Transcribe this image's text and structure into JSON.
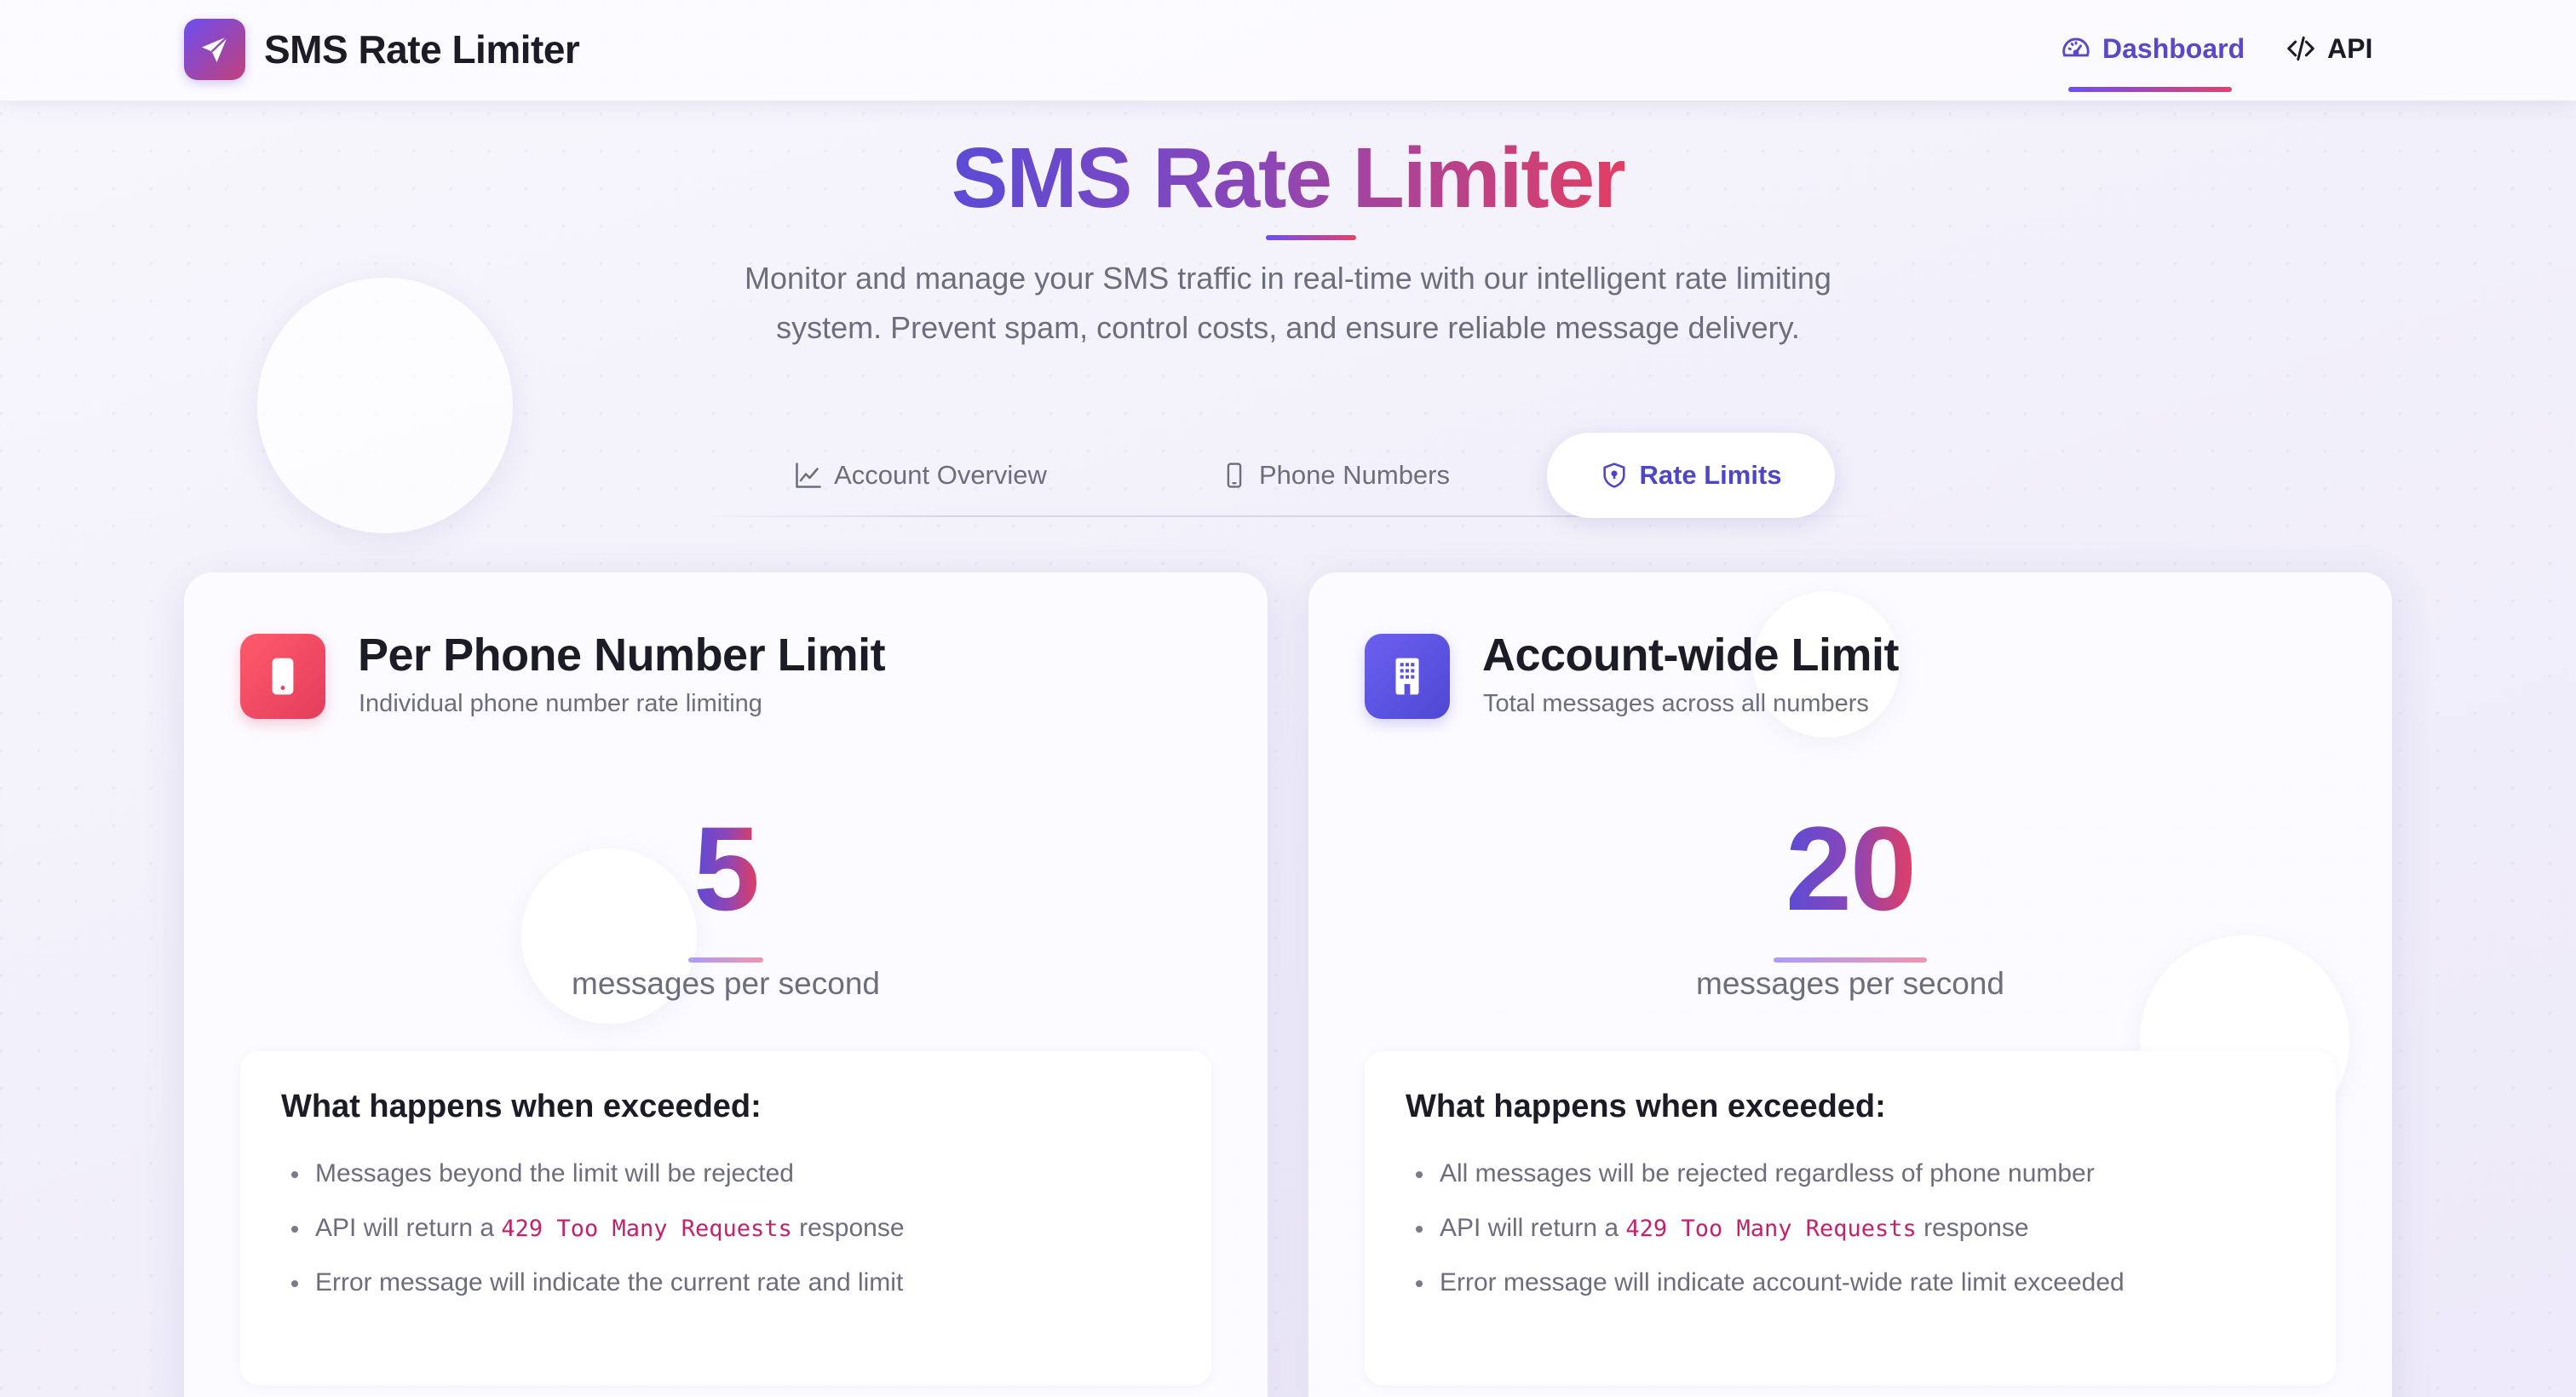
{
  "app": {
    "brand_name": "SMS Rate Limiter",
    "accent_gradient": [
      "#6d4ef0",
      "#e2426b"
    ]
  },
  "nav": {
    "items": [
      {
        "label": "Dashboard",
        "icon": "gauge-icon",
        "active": true
      },
      {
        "label": "API",
        "icon": "code-icon",
        "active": false
      }
    ]
  },
  "hero": {
    "title": "SMS Rate Limiter",
    "subtitle_line1": "Monitor and manage your SMS traffic in real-time with our intelligent rate limiting",
    "subtitle_line2": "system. Prevent spam, control costs, and ensure reliable message delivery."
  },
  "tabs": [
    {
      "label": "Account Overview",
      "icon": "line-chart-icon",
      "active": false
    },
    {
      "label": "Phone Numbers",
      "icon": "smartphone-icon",
      "active": false
    },
    {
      "label": "Rate Limits",
      "icon": "shield-icon",
      "active": true
    }
  ],
  "cards": [
    {
      "title": "Per Phone Number Limit",
      "subtitle": "Individual phone number rate limiting",
      "icon": "phone-icon",
      "icon_color": "#e33d5e",
      "limit_value": "5",
      "limit_unit": "messages per second",
      "info_heading": "What happens when exceeded:",
      "bullets": [
        {
          "text": "Messages beyond the limit will be rejected"
        },
        {
          "pre": "API will return a ",
          "code": "429 Too Many Requests",
          "post": " response"
        },
        {
          "text": "Error message will indicate the current rate and limit"
        }
      ]
    },
    {
      "title": "Account-wide Limit",
      "subtitle": "Total messages across all numbers",
      "icon": "building-icon",
      "icon_color": "#5a50e0",
      "limit_value": "20",
      "limit_unit": "messages per second",
      "info_heading": "What happens when exceeded:",
      "bullets": [
        {
          "text": "All messages will be rejected regardless of phone number"
        },
        {
          "pre": "API will return a ",
          "code": "429 Too Many Requests",
          "post": " response"
        },
        {
          "text": "Error message will indicate account-wide rate limit exceeded"
        }
      ]
    }
  ]
}
